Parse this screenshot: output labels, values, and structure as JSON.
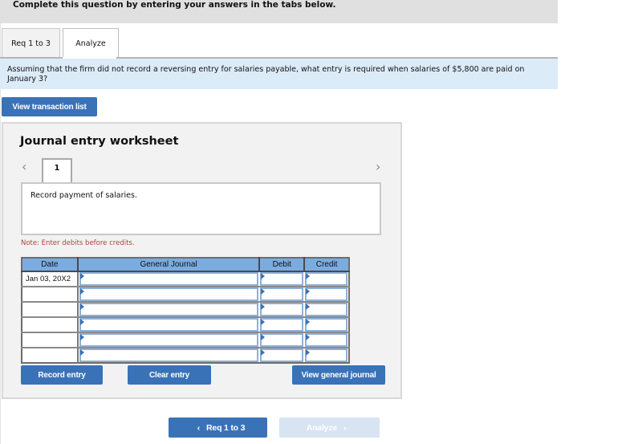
{
  "header": {
    "instruction": "Complete this question by entering your answers in the tabs below."
  },
  "tabs": [
    {
      "label": "Req 1 to 3",
      "active": false
    },
    {
      "label": "Analyze",
      "active": true
    }
  ],
  "question": {
    "text": "Assuming that the firm did not record a reversing entry for salaries payable, what entry is required when salaries of $5,800 are paid on January 3?"
  },
  "buttons": {
    "view_transaction_list": "View transaction list",
    "record_entry": "Record entry",
    "clear_entry": "Clear entry",
    "view_general_journal": "View general journal"
  },
  "worksheet": {
    "title": "Journal entry worksheet",
    "prev_icon": "chevron-left-icon",
    "next_icon": "chevron-right-icon",
    "entry_tabs": [
      "1"
    ],
    "description": "Record payment of salaries.",
    "note": "Note: Enter debits before credits.",
    "table": {
      "headers": [
        "Date",
        "General Journal",
        "Debit",
        "Credit"
      ],
      "rows": [
        {
          "date": "Jan 03, 20X2",
          "account": "",
          "debit": "",
          "credit": ""
        },
        {
          "date": "",
          "account": "",
          "debit": "",
          "credit": ""
        },
        {
          "date": "",
          "account": "",
          "debit": "",
          "credit": ""
        },
        {
          "date": "",
          "account": "",
          "debit": "",
          "credit": ""
        },
        {
          "date": "",
          "account": "",
          "debit": "",
          "credit": ""
        },
        {
          "date": "",
          "account": "",
          "debit": "",
          "credit": ""
        }
      ]
    }
  },
  "footer_nav": {
    "prev_label": "Req 1 to 3",
    "prev_icon": "chevron-left-icon",
    "next_label": "Analyze",
    "next_icon": "chevron-right-icon",
    "next_disabled": true
  },
  "colors": {
    "primary_button": "#3a72b8",
    "disabled_button": "#d8e4f2",
    "question_bg": "#dcebf8",
    "table_header": "#7aacdf",
    "note_text": "#b0413e"
  }
}
